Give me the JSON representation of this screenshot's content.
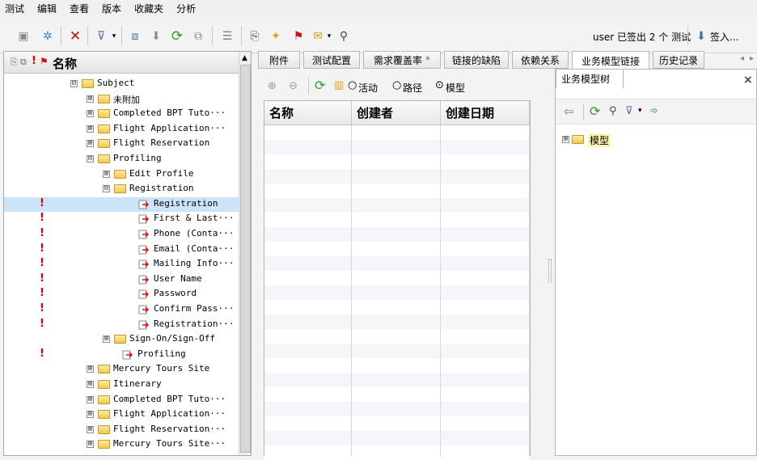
{
  "menu": [
    "测试",
    "编辑",
    "查看",
    "版本",
    "收藏夹",
    "分析"
  ],
  "toolbar": {
    "user_status": "user 已签出 2 个 测试",
    "checkin_label": "签入..."
  },
  "tree": {
    "header_label": "名称",
    "rows": [
      {
        "label": "Subject",
        "toggle": "⊟",
        "type": "folder",
        "level": 0,
        "flag": false,
        "selected": false
      },
      {
        "label": "未附加",
        "toggle": "⊞",
        "type": "folder",
        "level": 1,
        "flag": false,
        "selected": false
      },
      {
        "label": "Completed BPT Tuto···",
        "toggle": "⊞",
        "type": "folder",
        "level": 1,
        "flag": false,
        "selected": false
      },
      {
        "label": "Flight Application···",
        "toggle": "⊞",
        "type": "folder",
        "level": 1,
        "flag": false,
        "selected": false
      },
      {
        "label": "Flight Reservation",
        "toggle": "⊞",
        "type": "folder",
        "level": 1,
        "flag": false,
        "selected": false
      },
      {
        "label": "Profiling",
        "toggle": "⊟",
        "type": "folder",
        "level": 1,
        "flag": false,
        "selected": false
      },
      {
        "label": "Edit Profile",
        "toggle": "⊞",
        "type": "folder",
        "level": 2,
        "flag": false,
        "selected": false
      },
      {
        "label": "Registration",
        "toggle": "⊟",
        "type": "folder",
        "level": 2,
        "flag": false,
        "selected": false
      },
      {
        "label": "Registration",
        "toggle": "",
        "type": "test",
        "level": 3,
        "flag": true,
        "selected": true
      },
      {
        "label": "First & Last···",
        "toggle": "",
        "type": "test",
        "level": 3,
        "flag": true,
        "selected": false
      },
      {
        "label": "Phone (Conta···",
        "toggle": "",
        "type": "test",
        "level": 3,
        "flag": true,
        "selected": false
      },
      {
        "label": "Email (Conta···",
        "toggle": "",
        "type": "test",
        "level": 3,
        "flag": true,
        "selected": false
      },
      {
        "label": "Mailing Info···",
        "toggle": "",
        "type": "test",
        "level": 3,
        "flag": true,
        "selected": false
      },
      {
        "label": "User Name",
        "toggle": "",
        "type": "test",
        "level": 3,
        "flag": true,
        "selected": false
      },
      {
        "label": "Password",
        "toggle": "",
        "type": "test",
        "level": 3,
        "flag": true,
        "selected": false
      },
      {
        "label": "Confirm Pass···",
        "toggle": "",
        "type": "test",
        "level": 3,
        "flag": true,
        "selected": false
      },
      {
        "label": "Registration···",
        "toggle": "",
        "type": "test",
        "level": 3,
        "flag": true,
        "selected": false
      },
      {
        "label": "Sign-On/Sign-Off",
        "toggle": "⊞",
        "type": "folder",
        "level": 2,
        "flag": false,
        "selected": false
      },
      {
        "label": "Profiling",
        "toggle": "",
        "type": "test",
        "level": 2,
        "flag": true,
        "selected": false
      },
      {
        "label": "Mercury Tours Site",
        "toggle": "⊞",
        "type": "folder",
        "level": 1,
        "flag": false,
        "selected": false
      },
      {
        "label": "Itinerary",
        "toggle": "⊞",
        "type": "folder",
        "level": 1,
        "flag": false,
        "selected": false
      },
      {
        "label": "Completed BPT Tuto···",
        "toggle": "⊞",
        "type": "folder",
        "level": 1,
        "flag": false,
        "selected": false
      },
      {
        "label": "Flight Application···",
        "toggle": "⊞",
        "type": "folder",
        "level": 1,
        "flag": false,
        "selected": false
      },
      {
        "label": "Flight Reservation···",
        "toggle": "⊞",
        "type": "folder",
        "level": 1,
        "flag": false,
        "selected": false
      },
      {
        "label": "Mercury Tours Site···",
        "toggle": "⊞",
        "type": "folder",
        "level": 1,
        "flag": false,
        "selected": false
      }
    ]
  },
  "tabs": [
    "附件",
    "测试配置",
    "需求覆盖率",
    "链接的缺陷",
    "依赖关系",
    "业务模型链接",
    "历史记录"
  ],
  "active_tab_index": 5,
  "center": {
    "radio_options": [
      "活动",
      "路径",
      "模型"
    ],
    "selected_radio": "模型",
    "columns": [
      "名称",
      "创建者",
      "创建日期"
    ]
  },
  "right": {
    "title": "业务模型树",
    "close_symbol": "×",
    "root_toggle": "⊞",
    "root_label": "模型"
  },
  "colors": {
    "flag": "#e00000",
    "selection": "#cce4f7",
    "refresh_green": "#2e9a2e"
  }
}
